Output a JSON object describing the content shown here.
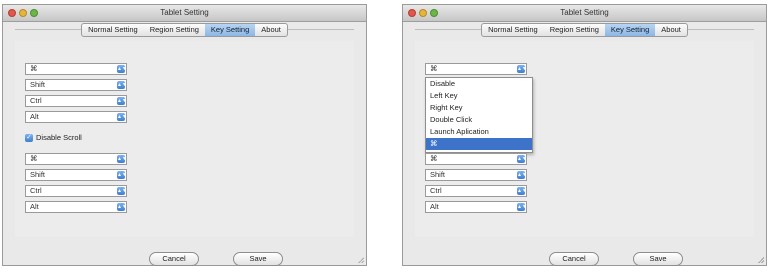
{
  "windows": [
    {
      "title": "Tablet Setting",
      "tabs": [
        "Normal Setting",
        "Region Setting",
        "Key Setting",
        "About"
      ],
      "active_tab": "Key Setting",
      "group1": [
        "⌘",
        "Shift",
        "Ctrl",
        "Alt"
      ],
      "checkbox_label": "Disable Scroll",
      "checkbox_checked": true,
      "group2": [
        "⌘",
        "Shift",
        "Ctrl",
        "Alt"
      ],
      "cancel_label": "Cancel",
      "save_label": "Save"
    },
    {
      "title": "Tablet Setting",
      "tabs": [
        "Normal Setting",
        "Region Setting",
        "Key Setting",
        "About"
      ],
      "active_tab": "Key Setting",
      "first_select_value": "⌘",
      "dropdown_options": [
        "Disable",
        "Left Key",
        "Right Key",
        "Double Click",
        "Launch Aplication",
        "⌘"
      ],
      "dropdown_highlighted": "⌘",
      "group2": [
        "⌘",
        "Shift",
        "Ctrl",
        "Alt"
      ],
      "cancel_label": "Cancel",
      "save_label": "Save"
    }
  ]
}
